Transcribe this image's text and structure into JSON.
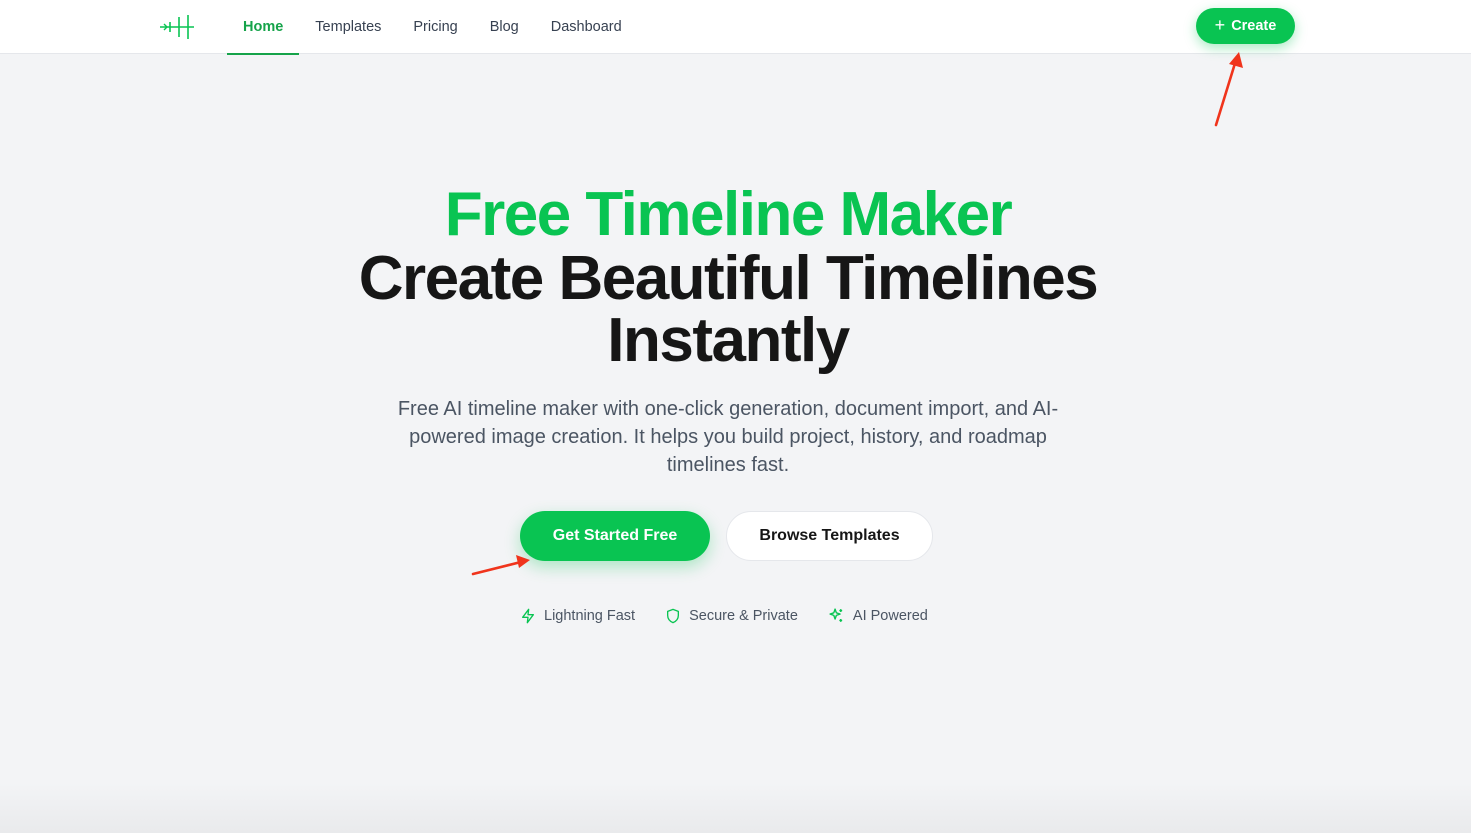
{
  "nav": {
    "logo_icon": "timeline-logo-icon",
    "links": [
      {
        "label": "Home",
        "active": true
      },
      {
        "label": "Templates",
        "active": false
      },
      {
        "label": "Pricing",
        "active": false
      },
      {
        "label": "Blog",
        "active": false
      },
      {
        "label": "Dashboard",
        "active": false
      }
    ],
    "create_label": "Create",
    "create_icon": "plus-icon"
  },
  "hero": {
    "title_highlight": "Free Timeline Maker",
    "title_line_1": "Create Beautiful Timelines",
    "title_line_2": "Instantly",
    "subtitle": "Free AI timeline maker with one-click generation, document import, and AI-powered image creation. It helps you build project, history, and roadmap timelines fast.",
    "primary_cta": "Get Started Free",
    "secondary_cta": "Browse Templates",
    "features": [
      {
        "icon": "lightning-icon",
        "label": "Lightning Fast"
      },
      {
        "icon": "shield-icon",
        "label": "Secure & Private"
      },
      {
        "icon": "sparkles-icon",
        "label": "AI Powered"
      }
    ]
  },
  "colors": {
    "brand_green": "#09c452",
    "text_dark": "#161616",
    "text_muted": "#4b5563",
    "background": "#f3f4f6",
    "annotation_red": "#f0341c"
  }
}
